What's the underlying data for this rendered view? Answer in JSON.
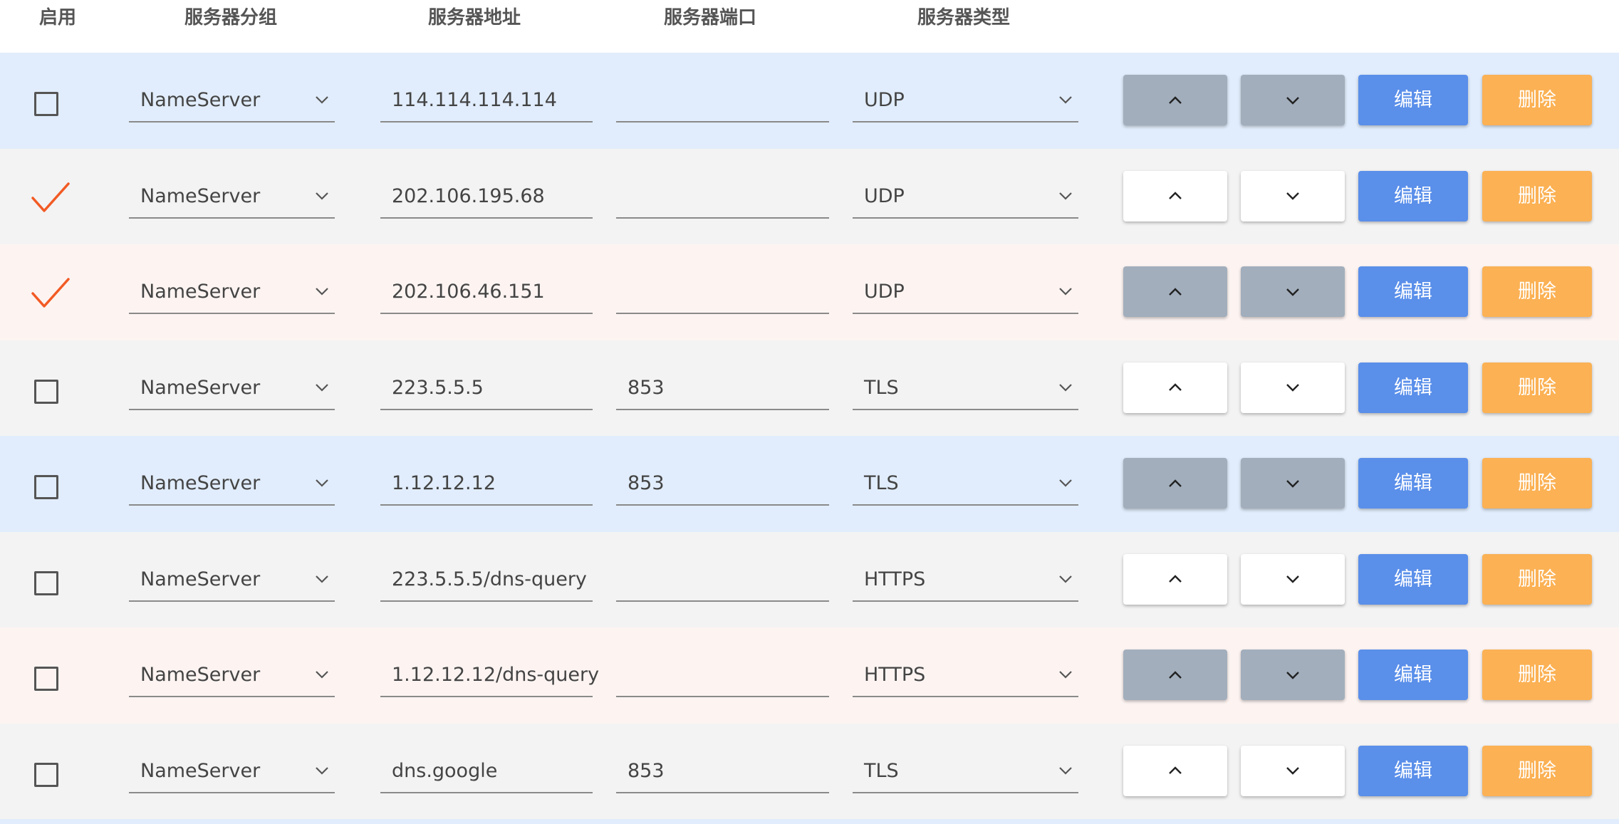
{
  "header": {
    "enabled": "启用",
    "group": "服务器分组",
    "address": "服务器地址",
    "port": "服务器端口",
    "type": "服务器类型"
  },
  "buttons": {
    "edit_label": "编辑",
    "delete_label": "删除"
  },
  "icons": {
    "move_up": "chevron-up-icon",
    "move_down": "chevron-down-icon",
    "select_arrow": "chevron-down-icon",
    "checked": "checkmark-icon"
  },
  "colors": {
    "row_blue": "#e1edfc",
    "row_gray": "#f3f3f3",
    "row_pink": "#fdf4f2",
    "edit_button": "#5a8fea",
    "delete_button": "#fbb154",
    "move_button_shaded": "#a2aebc",
    "checkmark": "#f25a24"
  },
  "rows": [
    {
      "enabled": false,
      "group": "NameServer",
      "address": "114.114.114.114",
      "port": "",
      "type": "UDP"
    },
    {
      "enabled": true,
      "group": "NameServer",
      "address": "202.106.195.68",
      "port": "",
      "type": "UDP"
    },
    {
      "enabled": true,
      "group": "NameServer",
      "address": "202.106.46.151",
      "port": "",
      "type": "UDP"
    },
    {
      "enabled": false,
      "group": "NameServer",
      "address": "223.5.5.5",
      "port": "853",
      "type": "TLS"
    },
    {
      "enabled": false,
      "group": "NameServer",
      "address": "1.12.12.12",
      "port": "853",
      "type": "TLS"
    },
    {
      "enabled": false,
      "group": "NameServer",
      "address": "223.5.5.5/dns-query",
      "port": "",
      "type": "HTTPS"
    },
    {
      "enabled": false,
      "group": "NameServer",
      "address": "1.12.12.12/dns-query",
      "port": "",
      "type": "HTTPS"
    },
    {
      "enabled": false,
      "group": "NameServer",
      "address": "dns.google",
      "port": "853",
      "type": "TLS"
    }
  ]
}
